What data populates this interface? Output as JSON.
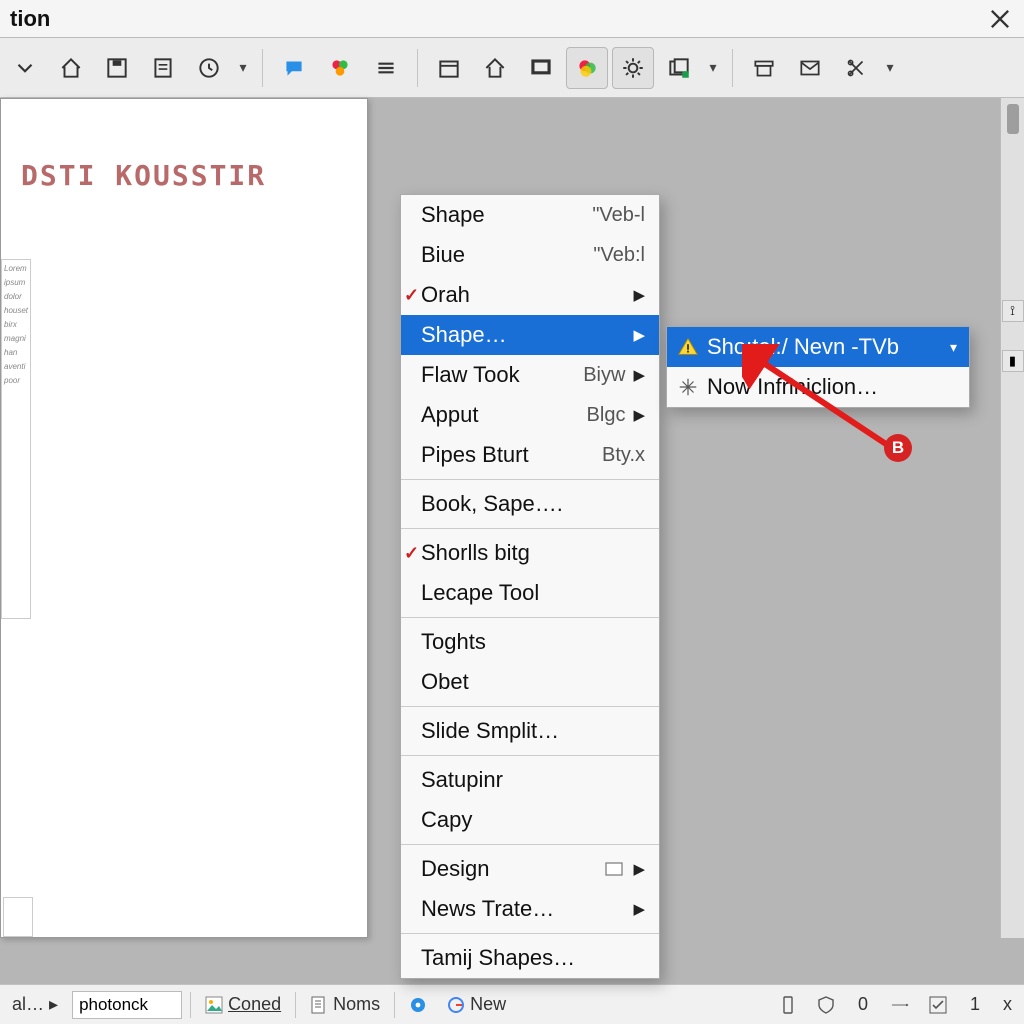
{
  "window": {
    "title_fragment": "tion",
    "close_label": "×"
  },
  "toolbar": {
    "icons": [
      "open-arrow-icon",
      "home-icon",
      "floppy-icon",
      "sheet-icon",
      "clock-icon",
      "chevron-down-icon",
      "separator",
      "chat-icon",
      "flower-icon",
      "list-icon",
      "separator",
      "calendar-icon",
      "home-outline-icon",
      "display-icon",
      "color-circles-icon",
      "gear-icon",
      "stack-icon",
      "chevron-down-icon",
      "separator",
      "archive-icon",
      "envelope-icon",
      "scissors-icon",
      "chevron-down-icon"
    ]
  },
  "document": {
    "heading": "DSTI  KOUSSTIR",
    "tiny_lines": "Lorem\nipsum\ndolor\nhouset\nbirx\nmagni\nhan\naventi\npoor"
  },
  "menu": {
    "items": [
      {
        "label": "Shape",
        "accel": "\"Veb-l"
      },
      {
        "label": "Biue",
        "accel": "\"Veb:l"
      },
      {
        "label": "Orah",
        "checked": true,
        "submenu": true
      },
      {
        "label": "Shape…",
        "highlight": true,
        "submenu": true
      },
      {
        "label": "Flaw Took",
        "accel": "Biyw",
        "submenu": true
      },
      {
        "label": "Apput",
        "accel": "Blgc",
        "submenu": true
      },
      {
        "label": "Pipes Bturt",
        "accel": "Bty.x"
      },
      {
        "separator": true
      },
      {
        "label": "Book, Sape…."
      },
      {
        "separator": true
      },
      {
        "label": "Shorlls bitg",
        "checked": true
      },
      {
        "label": "Lecape Tool"
      },
      {
        "separator": true
      },
      {
        "label": "Toghts"
      },
      {
        "label": "Obet"
      },
      {
        "separator": true
      },
      {
        "label": "Slide Smplit…"
      },
      {
        "separator": true
      },
      {
        "label": "Satupinr"
      },
      {
        "label": "Capy"
      },
      {
        "separator": true
      },
      {
        "label": "Design",
        "icon": true,
        "submenu": true
      },
      {
        "label": "News Trate…",
        "submenu": true
      },
      {
        "separator": true
      },
      {
        "label": "Tamij Shapes…"
      }
    ]
  },
  "submenu": {
    "items": [
      {
        "label": "Sho:tel:/ Nevn -TVb",
        "icon": "warning-icon",
        "highlight": true,
        "dropdown": true
      },
      {
        "label": "Now Infriniclion…",
        "icon": "sparkle-icon"
      }
    ]
  },
  "annotation": {
    "badge": "B"
  },
  "statusbar": {
    "left_label": "al…",
    "search_value": "photonck",
    "coned_label": "Coned",
    "noms_label": "Noms",
    "new_label": "New",
    "count_value": "0",
    "page_value": "1",
    "close_x": "x"
  }
}
